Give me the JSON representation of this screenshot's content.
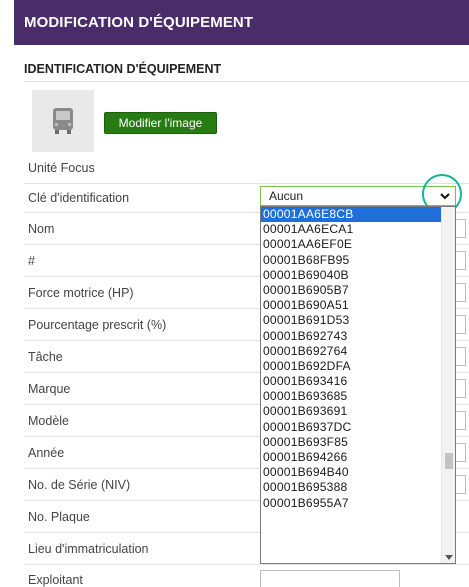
{
  "header": {
    "title": "MODIFICATION D'ÉQUIPEMENT"
  },
  "section": {
    "title": "IDENTIFICATION D'ÉQUIPEMENT"
  },
  "image": {
    "button_label": "Modifier l'image",
    "icon": "truck-icon"
  },
  "focus_label": "Unité Focus",
  "form": {
    "key_label": "Clé d'identification",
    "key_selected": "Aucun",
    "rows": [
      {
        "label": "Nom"
      },
      {
        "label": "#"
      },
      {
        "label": "Force motrice (HP)"
      },
      {
        "label": "Pourcentage prescrit (%)"
      },
      {
        "label": "Tâche"
      },
      {
        "label": "Marque"
      },
      {
        "label": "Modèle"
      },
      {
        "label": "Année"
      },
      {
        "label": "No. de Série (NIV)"
      },
      {
        "label": "No. Plaque"
      },
      {
        "label": "Lieu d'immatriculation"
      },
      {
        "label": "Exploitant"
      }
    ]
  },
  "dropdown": {
    "options": [
      "00001AA6E8CB",
      "00001AA6ECA1",
      "00001AA6EF0E",
      "00001B68FB95",
      "00001B69040B",
      "00001B6905B7",
      "00001B690A51",
      "00001B691D53",
      "00001B692743",
      "00001B692764",
      "00001B692DFA",
      "00001B693416",
      "00001B693685",
      "00001B693691",
      "00001B6937DC",
      "00001B693F85",
      "00001B694266",
      "00001B694B40",
      "00001B695388",
      "00001B6955A7"
    ],
    "highlighted_index": 0
  },
  "colors": {
    "header_bg": "#4b2c6b",
    "button_bg": "#267b12",
    "highlight": "#1e6fd9",
    "circle": "#18b19a"
  }
}
